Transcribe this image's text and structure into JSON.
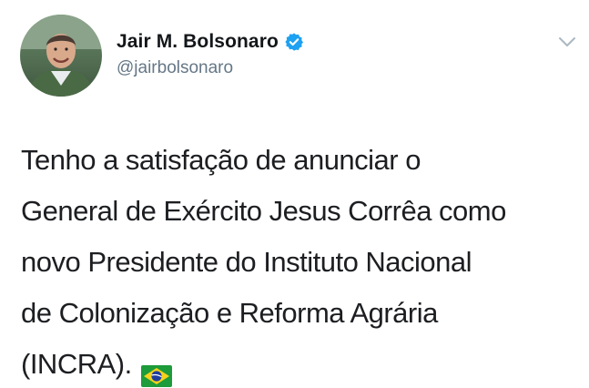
{
  "tweet": {
    "author": {
      "display_name": "Jair M. Bolsonaro",
      "handle": "@jairbolsonaro",
      "verified": true
    },
    "text_lines": [
      "Tenho a satisfação de anunciar o",
      "General de Exército Jesus Corrêa como",
      "novo Presidente do Instituto Nacional",
      "de Colonização e Reforma Agrária",
      "(INCRA)."
    ],
    "emoji": "brazil-flag"
  },
  "colors": {
    "verified_blue": "#1da1f2",
    "handle_gray": "#657786",
    "chevron_gray": "#aab8c2",
    "text": "#1c1e21"
  },
  "icons": {
    "verified": "verified-badge-icon",
    "menu": "chevron-down-icon",
    "flag": "brazil-flag-icon"
  }
}
